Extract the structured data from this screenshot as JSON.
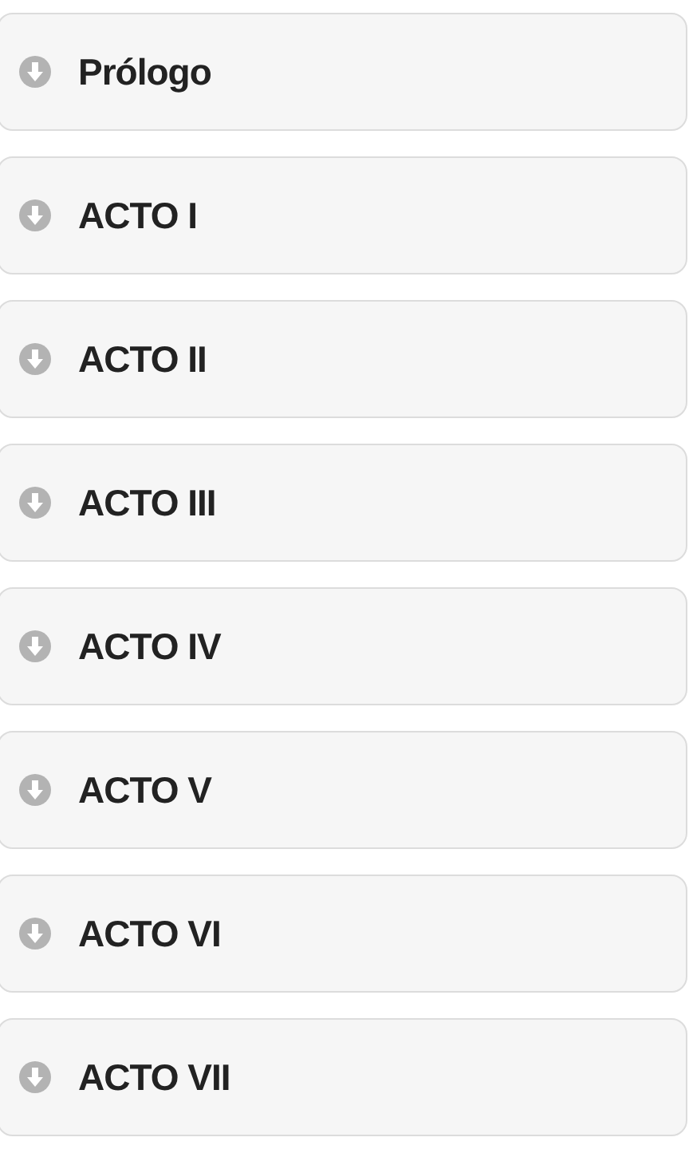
{
  "items": [
    {
      "label": "Prólogo"
    },
    {
      "label": "ACTO I"
    },
    {
      "label": "ACTO II"
    },
    {
      "label": "ACTO III"
    },
    {
      "label": "ACTO IV"
    },
    {
      "label": "ACTO V"
    },
    {
      "label": "ACTO VI"
    },
    {
      "label": "ACTO VII"
    }
  ]
}
